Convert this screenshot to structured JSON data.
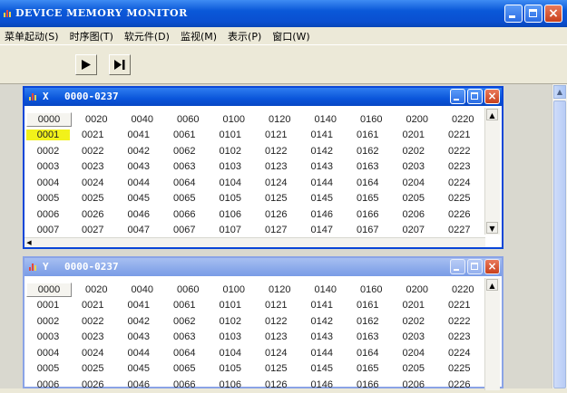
{
  "window": {
    "title": "DEVICE MEMORY MONITOR",
    "close_glyph": "×"
  },
  "menu": [
    "菜单起动(S)",
    "时序图(T)",
    "软元件(D)",
    "监视(M)",
    "表示(P)",
    "窗口(W)"
  ],
  "toolbar": {
    "buttons": [
      {
        "name": "run-icon"
      },
      {
        "name": "step-icon"
      }
    ]
  },
  "colors": {
    "title_active": "#0a55da",
    "title_inactive": "#8aa9ea",
    "highlight": "#f2f21a"
  },
  "monitors": [
    {
      "device": "X",
      "range": "0000-0237",
      "active": true,
      "highlight": "0001",
      "rows": [
        [
          "0000",
          "0020",
          "0040",
          "0060",
          "0100",
          "0120",
          "0140",
          "0160",
          "0200",
          "0220"
        ],
        [
          "0001",
          "0021",
          "0041",
          "0061",
          "0101",
          "0121",
          "0141",
          "0161",
          "0201",
          "0221"
        ],
        [
          "0002",
          "0022",
          "0042",
          "0062",
          "0102",
          "0122",
          "0142",
          "0162",
          "0202",
          "0222"
        ],
        [
          "0003",
          "0023",
          "0043",
          "0063",
          "0103",
          "0123",
          "0143",
          "0163",
          "0203",
          "0223"
        ],
        [
          "0004",
          "0024",
          "0044",
          "0064",
          "0104",
          "0124",
          "0144",
          "0164",
          "0204",
          "0224"
        ],
        [
          "0005",
          "0025",
          "0045",
          "0065",
          "0105",
          "0125",
          "0145",
          "0165",
          "0205",
          "0225"
        ],
        [
          "0006",
          "0026",
          "0046",
          "0066",
          "0106",
          "0126",
          "0146",
          "0166",
          "0206",
          "0226"
        ],
        [
          "0007",
          "0027",
          "0047",
          "0067",
          "0107",
          "0127",
          "0147",
          "0167",
          "0207",
          "0227"
        ]
      ]
    },
    {
      "device": "Y",
      "range": "0000-0237",
      "active": false,
      "rows": [
        [
          "0000",
          "0020",
          "0040",
          "0060",
          "0100",
          "0120",
          "0140",
          "0160",
          "0200",
          "0220"
        ],
        [
          "0001",
          "0021",
          "0041",
          "0061",
          "0101",
          "0121",
          "0141",
          "0161",
          "0201",
          "0221"
        ],
        [
          "0002",
          "0022",
          "0042",
          "0062",
          "0102",
          "0122",
          "0142",
          "0162",
          "0202",
          "0222"
        ],
        [
          "0003",
          "0023",
          "0043",
          "0063",
          "0103",
          "0123",
          "0143",
          "0163",
          "0203",
          "0223"
        ],
        [
          "0004",
          "0024",
          "0044",
          "0064",
          "0104",
          "0124",
          "0144",
          "0164",
          "0204",
          "0224"
        ],
        [
          "0005",
          "0025",
          "0045",
          "0065",
          "0105",
          "0125",
          "0145",
          "0165",
          "0205",
          "0225"
        ],
        [
          "0006",
          "0026",
          "0046",
          "0066",
          "0106",
          "0126",
          "0146",
          "0166",
          "0206",
          "0226"
        ]
      ]
    }
  ]
}
